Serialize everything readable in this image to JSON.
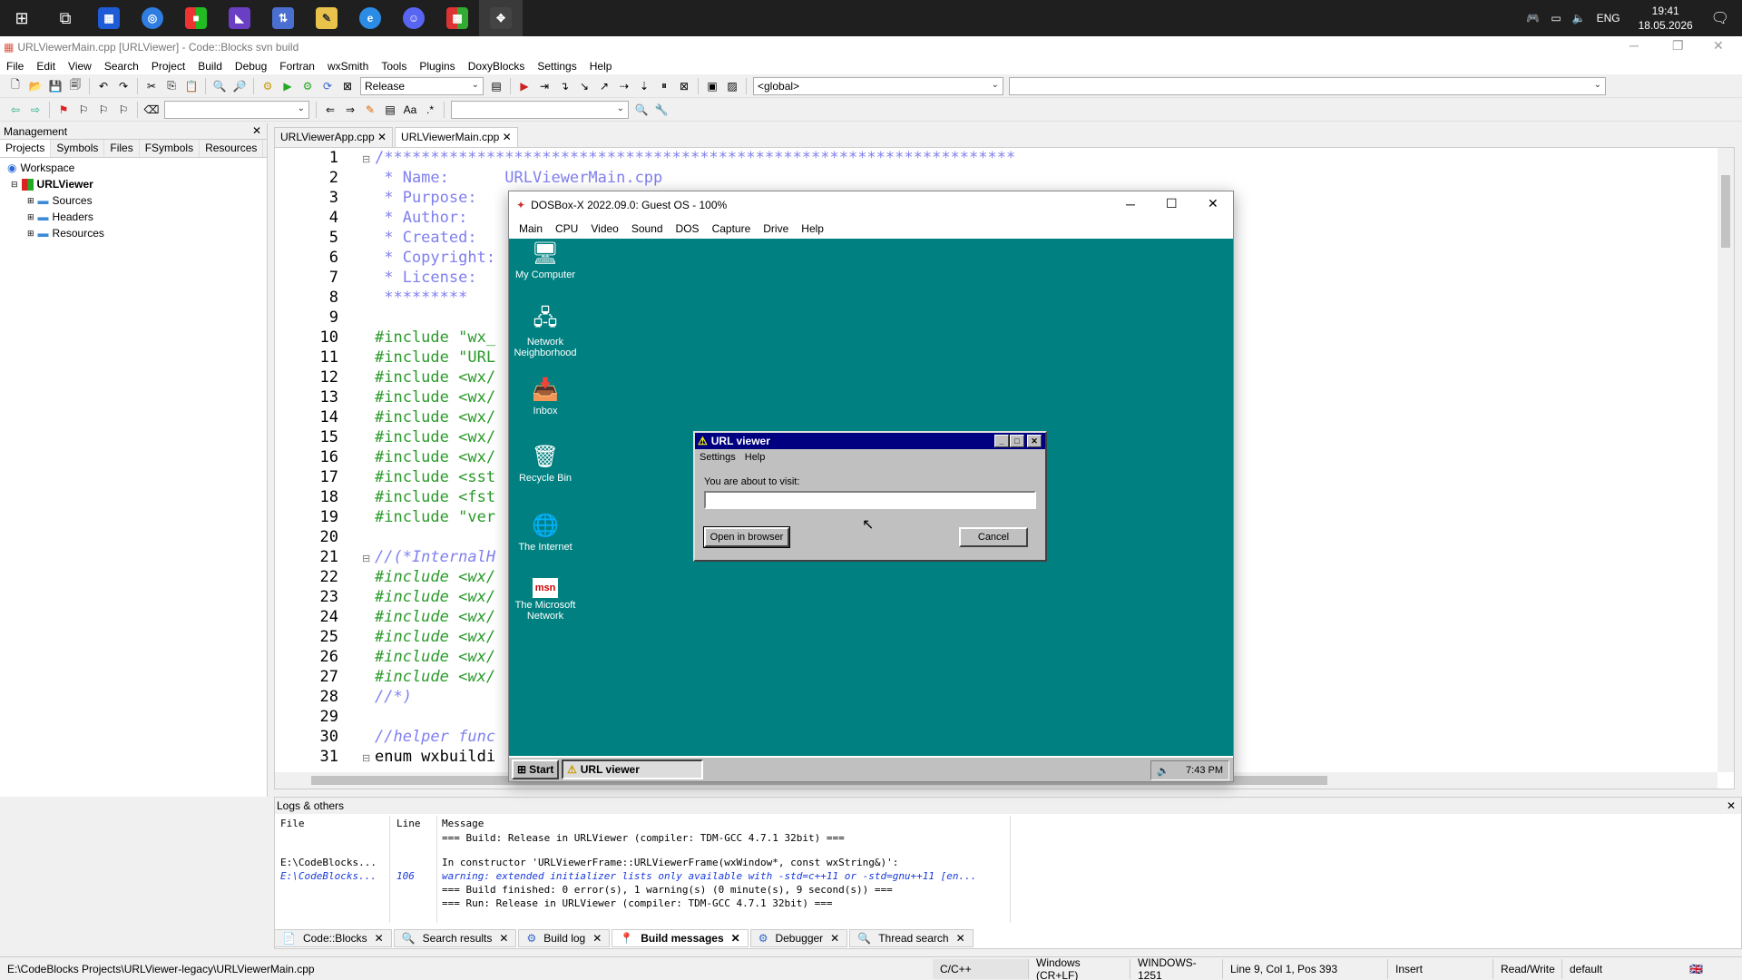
{
  "taskbar": {
    "clock_time": "19:41",
    "clock_date": "18.05.2026",
    "lang": "ENG",
    "apps": [
      "windows-icon",
      "task-view-icon",
      "calendar-app-icon",
      "chrome-icon",
      "office-icon",
      "visual-studio-icon",
      "network-tool-icon",
      "pen-tool-icon",
      "edge-icon",
      "discord-icon",
      "minecraft-icon",
      "codeblocks-icon"
    ]
  },
  "cb": {
    "title": "URLViewerMain.cpp [URLViewer] - Code::Blocks svn build",
    "menu": [
      "File",
      "Edit",
      "View",
      "Search",
      "Project",
      "Build",
      "Debug",
      "Fortran",
      "wxSmith",
      "Tools",
      "Plugins",
      "DoxyBlocks",
      "Settings",
      "Help"
    ],
    "build_target": "Release",
    "scope": "<global>",
    "management_title": "Management",
    "mgmt_tabs": [
      "Projects",
      "Symbols",
      "Files",
      "FSymbols",
      "Resources"
    ],
    "tree": {
      "workspace": "Workspace",
      "project": "URLViewer",
      "folders": [
        "Sources",
        "Headers",
        "Resources"
      ]
    },
    "editor_tabs": [
      "URLViewerApp.cpp",
      "URLViewerMain.cpp"
    ],
    "line_numbers": [
      "1",
      "2",
      "3",
      "4",
      "5",
      "6",
      "7",
      "8",
      "9",
      "10",
      "11",
      "12",
      "13",
      "14",
      "15",
      "16",
      "17",
      "18",
      "19",
      "20",
      "21",
      "22",
      "23",
      "24",
      "25",
      "26",
      "27",
      "28",
      "29",
      "30",
      "31"
    ],
    "code_lines": [
      "/********************************************************************",
      " * Name:      URLViewerMain.cpp",
      " * Purpose:",
      " * Author:",
      " * Created:",
      " * Copyright:",
      " * License:",
      " *********",
      "",
      "#include \"wx_",
      "#include \"URL",
      "#include <wx/",
      "#include <wx/",
      "#include <wx/",
      "#include <wx/",
      "#include <wx/",
      "#include <sst",
      "#include <fst",
      "#include \"ver",
      "",
      "//(*InternalH",
      "#include <wx/",
      "#include <wx/",
      "#include <wx/",
      "#include <wx/",
      "#include <wx/",
      "#include <wx/",
      "//*)",
      "",
      "//helper func",
      "enum wxbuildi"
    ],
    "logs_title": "Logs & others",
    "log_headers": {
      "file": "File",
      "line": "Line",
      "message": "Message"
    },
    "log_rows": [
      {
        "file": "",
        "line": "",
        "msg": "=== Build: Release in URLViewer (compiler: TDM-GCC 4.7.1 32bit) ===",
        "kind": "normal"
      },
      {
        "file": "E:\\CodeBlocks...",
        "line": "",
        "msg": "In constructor 'URLViewerFrame::URLViewerFrame(wxWindow*, const wxString&)':",
        "kind": "normal"
      },
      {
        "file": "E:\\CodeBlocks...",
        "line": "106",
        "msg": "warning: extended initializer lists only available with -std=c++11 or -std=gnu++11 [en...",
        "kind": "warn"
      },
      {
        "file": "",
        "line": "",
        "msg": "=== Build finished: 0 error(s), 1 warning(s) (0 minute(s), 9 second(s)) ===",
        "kind": "normal"
      },
      {
        "file": "",
        "line": "",
        "msg": "=== Run: Release in URLViewer (compiler: TDM-GCC 4.7.1 32bit) ===",
        "kind": "normal"
      }
    ],
    "log_tabs": [
      "Code::Blocks",
      "Search results",
      "Build log",
      "Build messages",
      "Debugger",
      "Thread search"
    ],
    "status": {
      "path": "E:\\CodeBlocks Projects\\URLViewer-legacy\\URLViewerMain.cpp",
      "lang": "C/C++",
      "eol": "Windows (CR+LF)",
      "enc": "WINDOWS-1251",
      "pos": "Line 9, Col 1, Pos 393",
      "mode": "Insert",
      "rw": "Read/Write",
      "profile": "default"
    }
  },
  "dosbox": {
    "title": "DOSBox-X 2022.09.0: Guest OS - 100%",
    "menu": [
      "Main",
      "CPU",
      "Video",
      "Sound",
      "DOS",
      "Capture",
      "Drive",
      "Help"
    ],
    "desktop_icons": [
      "My Computer",
      "Network Neighborhood",
      "Inbox",
      "Recycle Bin",
      "The Internet",
      "The Microsoft Network"
    ],
    "start_label": "Start",
    "task_label": "URL viewer",
    "tray_time": "7:43 PM"
  },
  "urlviewer": {
    "title": "URL viewer",
    "menu": [
      "Settings",
      "Help"
    ],
    "prompt": "You are about to visit:",
    "url_value": "",
    "open_button": "Open in browser",
    "cancel_button": "Cancel"
  }
}
